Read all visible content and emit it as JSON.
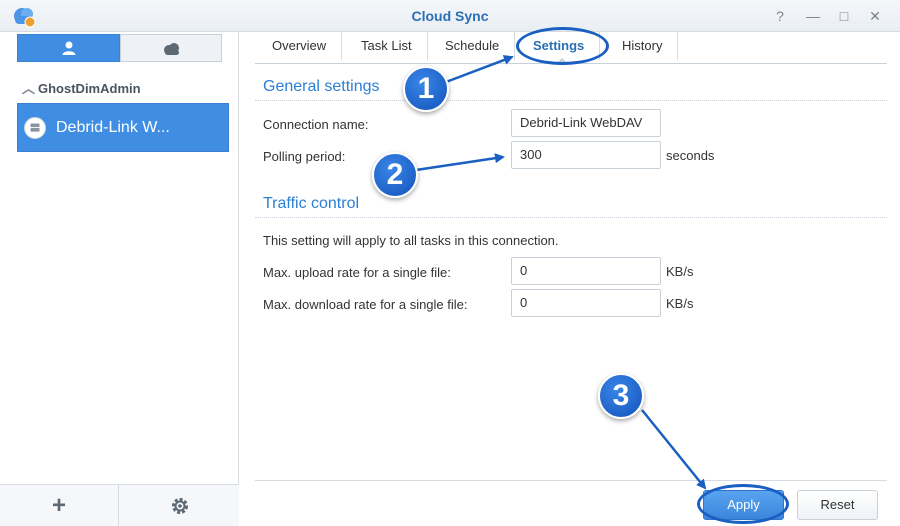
{
  "window": {
    "title": "Cloud Sync",
    "help": "?",
    "minimize": "—",
    "maximize": "□",
    "close": "✕"
  },
  "sidebar": {
    "group_name": "GhostDimAdmin",
    "connection_label": "Debrid-Link W..."
  },
  "tabs": [
    {
      "label": "Overview"
    },
    {
      "label": "Task List"
    },
    {
      "label": "Schedule"
    },
    {
      "label": "Settings"
    },
    {
      "label": "History"
    }
  ],
  "general": {
    "title": "General settings",
    "connection_name_label": "Connection name:",
    "connection_name_value": "Debrid-Link WebDAV",
    "polling_label": "Polling period:",
    "polling_value": "300",
    "polling_unit": "seconds"
  },
  "traffic": {
    "title": "Traffic control",
    "note": "This setting will apply to all tasks in this connection.",
    "upload_label": "Max. upload rate for a single file:",
    "upload_value": "0",
    "upload_unit": "KB/s",
    "download_label": "Max. download rate for a single file:",
    "download_value": "0",
    "download_unit": "KB/s"
  },
  "buttons": {
    "apply": "Apply",
    "reset": "Reset"
  },
  "annotations": {
    "one": "1",
    "two": "2",
    "three": "3"
  },
  "colors": {
    "accent": "#3f8ee3",
    "annotation": "#1a5fc2",
    "title": "#2b6fb5"
  }
}
